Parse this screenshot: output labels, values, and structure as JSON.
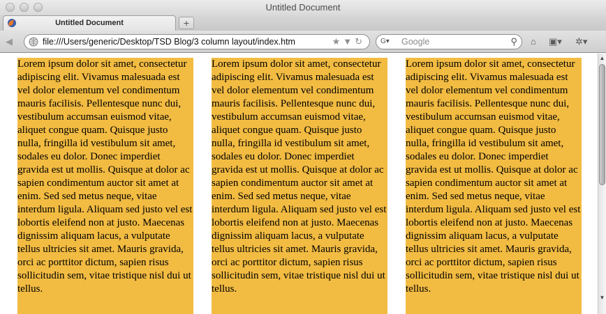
{
  "window": {
    "title": "Untitled Document"
  },
  "tabs": [
    {
      "label": "Untitled Document"
    }
  ],
  "toolbar": {
    "url": "file:///Users/generic/Desktop/TSD Blog/3 column layout/index.htm",
    "search_placeholder": "Google",
    "new_tab_symbol": "+"
  },
  "columns": [
    {
      "text": "Lorem ipsum dolor sit amet, consectetur adipiscing elit. Vivamus malesuada est vel dolor elementum vel condimentum mauris facilisis. Pellentesque nunc dui, vestibulum accumsan euismod vitae, aliquet congue quam. Quisque justo nulla, fringilla id vestibulum sit amet, sodales eu dolor. Donec imperdiet gravida est ut mollis. Quisque at dolor ac sapien condimentum auctor sit amet at enim. Sed sed metus neque, vitae interdum ligula. Aliquam sed justo vel est lobortis eleifend non at justo. Maecenas dignissim aliquam lacus, a vulputate tellus ultricies sit amet. Mauris gravida, orci ac porttitor dictum, sapien risus sollicitudin sem, vitae tristique nisl dui ut tellus."
    },
    {
      "text": "Lorem ipsum dolor sit amet, consectetur adipiscing elit. Vivamus malesuada est vel dolor elementum vel condimentum mauris facilisis. Pellentesque nunc dui, vestibulum accumsan euismod vitae, aliquet congue quam. Quisque justo nulla, fringilla id vestibulum sit amet, sodales eu dolor. Donec imperdiet gravida est ut mollis. Quisque at dolor ac sapien condimentum auctor sit amet at enim. Sed sed metus neque, vitae interdum ligula. Aliquam sed justo vel est lobortis eleifend non at justo. Maecenas dignissim aliquam lacus, a vulputate tellus ultricies sit amet. Mauris gravida, orci ac porttitor dictum, sapien risus sollicitudin sem, vitae tristique nisl dui ut tellus."
    },
    {
      "text": "Lorem ipsum dolor sit amet, consectetur adipiscing elit. Vivamus malesuada est vel dolor elementum vel condimentum mauris facilisis. Pellentesque nunc dui, vestibulum accumsan euismod vitae, aliquet congue quam. Quisque justo nulla, fringilla id vestibulum sit amet, sodales eu dolor. Donec imperdiet gravida est ut mollis. Quisque at dolor ac sapien condimentum auctor sit amet at enim. Sed sed metus neque, vitae interdum ligula. Aliquam sed justo vel est lobortis eleifend non at justo. Maecenas dignissim aliquam lacus, a vulputate tellus ultricies sit amet. Mauris gravida, orci ac porttitor dictum, sapien risus sollicitudin sem, vitae tristique nisl dui ut tellus."
    }
  ],
  "colors": {
    "column_background": "#f2bb42",
    "page_background": "#ffffff"
  },
  "icons": {
    "favicon": "firefox-icon",
    "back": "back-arrow-icon",
    "site": "globe-icon",
    "bookmark": "star-icon",
    "dropdown": "dropdown-arrow-icon",
    "reload": "reload-icon",
    "search_engine": "google-icon",
    "search": "magnifier-icon",
    "home": "home-icon",
    "bookmarks": "bookmarks-icon",
    "addons": "puzzle-icon"
  }
}
